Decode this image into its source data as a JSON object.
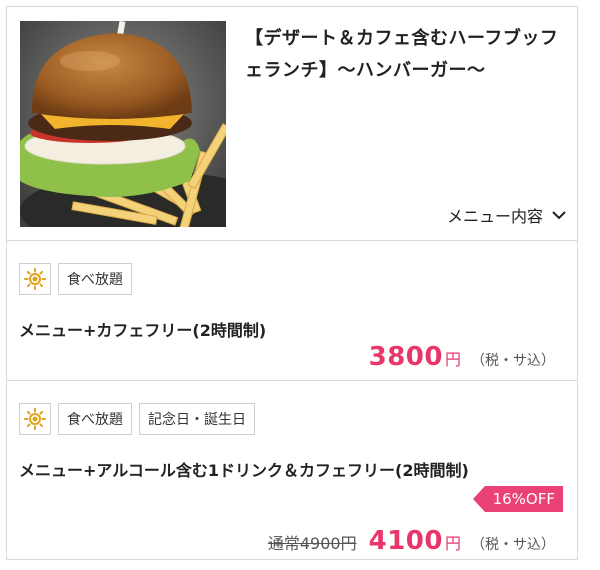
{
  "plan": {
    "title": "【デザート＆カフェ含むハーフブッフェランチ】〜ハンバーガー〜",
    "menu_toggle_label": "メニュー内容"
  },
  "courses": [
    {
      "tags": [
        "食べ放題"
      ],
      "name": "メニュー+カフェフリー(2時間制)",
      "price": "3800",
      "yen": "円",
      "tax_note": "（税・サ込）"
    },
    {
      "tags": [
        "食べ放題",
        "記念日・誕生日"
      ],
      "name": "メニュー+アルコール含む1ドリンク＆カフェフリー(2時間制)",
      "discount": "16%OFF",
      "original_price": "通常4900円",
      "price": "4100",
      "yen": "円",
      "tax_note": "（税・サ込）"
    }
  ],
  "colors": {
    "accent": "#e8366b",
    "badge": "#ea4275",
    "border": "#d8d8d8",
    "sun_icon": "#e0a21a"
  },
  "icons": [
    "sun-icon",
    "chevron-down-icon"
  ]
}
